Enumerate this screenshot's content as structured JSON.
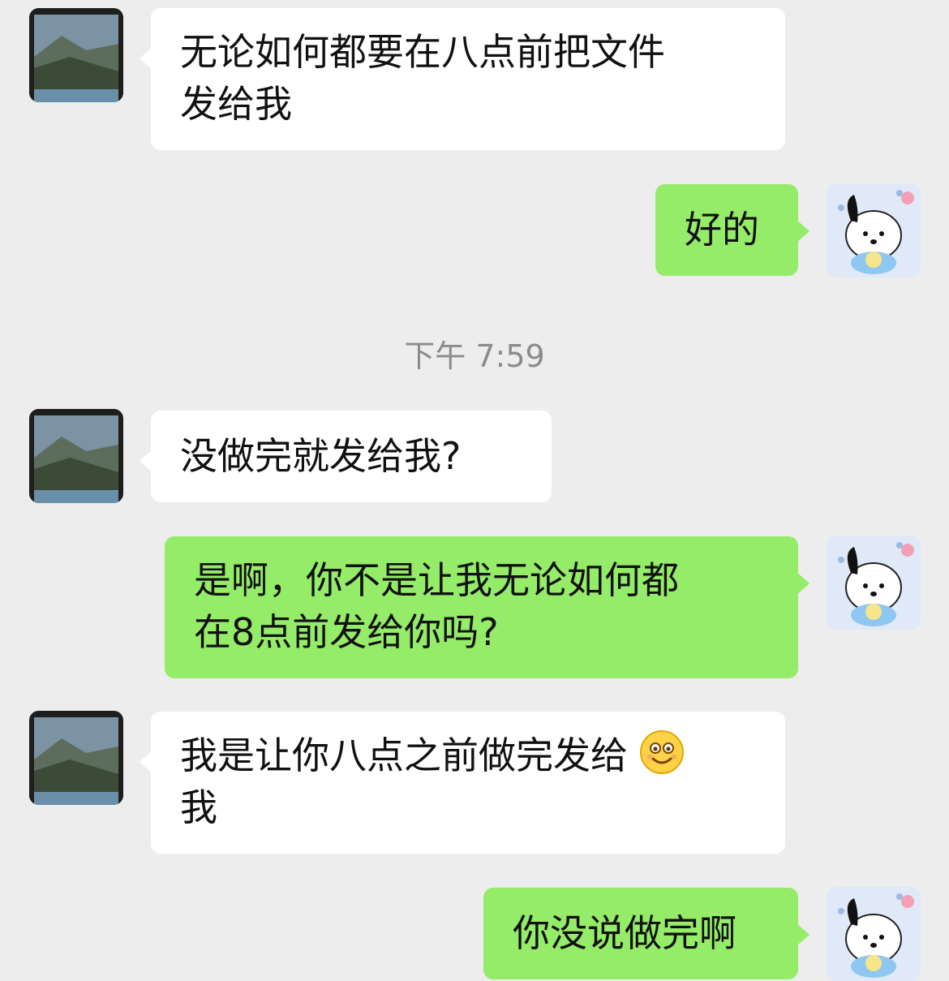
{
  "messages": [
    {
      "sender": "other",
      "lines": [
        "无论如何都要在八点前把文件",
        "发给我"
      ]
    },
    {
      "sender": "me",
      "lines": [
        "好的"
      ]
    },
    {
      "sender": "other",
      "lines": [
        "没做完就发给我?"
      ]
    },
    {
      "sender": "me",
      "lines": [
        "是啊，你不是让我无论如何都",
        "在8点前发给你吗?"
      ]
    },
    {
      "sender": "other",
      "lines": [
        "我是让你八点之前做完发给",
        "我"
      ],
      "emoji": "smile-emoji"
    },
    {
      "sender": "me",
      "lines": [
        "你没说做完啊"
      ]
    }
  ],
  "timestamp": "下午 7:59",
  "colors": {
    "background": "#ededed",
    "incoming_bubble": "#ffffff",
    "outgoing_bubble": "#95ec69",
    "timestamp_text": "#8b8b8b"
  },
  "icons": {
    "other_avatar": "landscape-photo-avatar",
    "my_avatar": "cartoon-dog-avatar"
  }
}
